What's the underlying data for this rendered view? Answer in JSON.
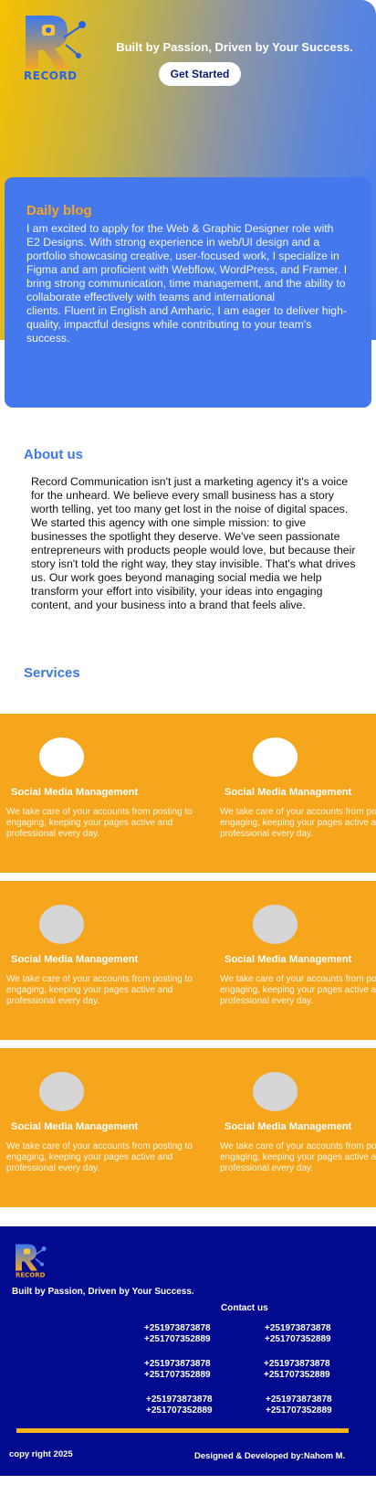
{
  "brand": {
    "logo_text": "RECORD",
    "tagline": "Built by Passion, Driven by Your Success.",
    "cta_label": "Get Started",
    "colors": {
      "blue": "#2a64e6",
      "orange": "#f5a61c",
      "navy": "#020b8f",
      "gold": "#f7c002"
    }
  },
  "blog": {
    "title": "Daily blog",
    "body": "I am excited to apply for the Web & Graphic Designer role with E2 Designs. With strong experience in web/UI design and a portfolio showcasing creative, user-focused work, I specialize in Figma and am proficient with Webflow, WordPress, and Framer. I bring strong communication, time management, and the ability to collaborate effectively with teams and international\nclients. Fluent in English and Amharic, I am eager to deliver high-quality, impactful designs while contributing to your team's\nsuccess."
  },
  "about": {
    "title": "About us",
    "body": "Record Communication isn't just a marketing agency it's a voice for the unheard. We believe every small business has a story worth telling, yet too many get lost in the noise of digital spaces. We started this agency with one simple mission: to give businesses the spotlight they deserve. We've seen passionate entrepreneurs with products people would love, but because their story isn't told the right way, they stay invisible. That's what drives us. Our work goes beyond managing social media we help transform your effort into visibility, your ideas into engaging content, and your business into a brand that feels alive."
  },
  "services": {
    "title": "Services",
    "rows": [
      {
        "items": [
          {
            "title": "Social Media Management",
            "desc": "We take care of your accounts from posting to engaging, keeping your pages active and professional every day.",
            "icon": "service-icon-placeholder"
          },
          {
            "title": "Social Media Management",
            "desc": "We take care of your accounts from posting to engaging, keeping your pages active and professional every day.",
            "icon": "service-icon-placeholder"
          }
        ]
      },
      {
        "items": [
          {
            "title": "Social Media Management",
            "desc": "We take care of your accounts from posting to engaging, keeping your pages active and professional every day.",
            "icon": "service-icon-placeholder"
          },
          {
            "title": "Social Media Management",
            "desc": "We take care of your accounts from posting to engaging, keeping your pages active and professional every day.",
            "icon": "service-icon-placeholder"
          }
        ]
      },
      {
        "items": [
          {
            "title": "Social Media Management",
            "desc": "We take care of your accounts from posting to engaging, keeping your pages active and professional every day.",
            "icon": "service-icon-placeholder"
          },
          {
            "title": "Social Media Management",
            "desc": "We take care of your accounts from posting to engaging, keeping your pages active and professional every day.",
            "icon": "service-icon-placeholder"
          }
        ]
      }
    ]
  },
  "footer": {
    "logo_text": "RECORD",
    "tagline": "Built by Passion, Driven by Your Success.",
    "contact_title": "Contact us",
    "phones": [
      {
        "line1": "+251973873878",
        "line2": "+251707352889"
      },
      {
        "line1": "+251973873878",
        "line2": "+251707352889"
      },
      {
        "line1": "+251973873878",
        "line2": "+251707352889"
      },
      {
        "line1": "+251973873878",
        "line2": "+251707352889"
      },
      {
        "line1": "+251973873878",
        "line2": "+251707352889"
      },
      {
        "line1": "+251973873878",
        "line2": "+251707352889"
      }
    ],
    "copyright": "copy right 2025",
    "credit": "Designed & Developed by:Nahom M."
  }
}
